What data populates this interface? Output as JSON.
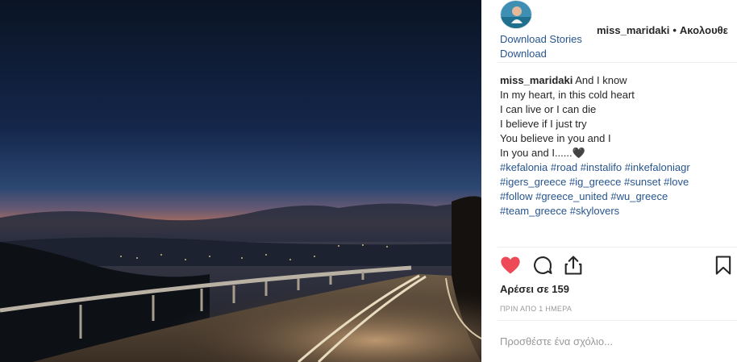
{
  "post": {
    "username": "miss_maridaki",
    "follow_label": "Ακολουθε",
    "dot": "•",
    "links": {
      "download_stories": "Download Stories",
      "download": "Download"
    },
    "caption": {
      "username": "miss_maridaki",
      "lines": [
        "And I know",
        "In my heart, in this cold heart",
        "I can live or I can die",
        "I believe if I just try",
        "You believe in you and I",
        "In you and I......🖤"
      ],
      "hashtag_lines": [
        [
          "#kefalonia",
          "#road",
          "#instalifo",
          "#inkefaloniagr"
        ],
        [
          "#igers_greece",
          "#ig_greece",
          "#sunset",
          "#love"
        ],
        [
          "#follow",
          "#greece_united",
          "#wu_greece"
        ],
        [
          "#team_greece",
          "#skylovers"
        ]
      ]
    },
    "likes_text": "Αρέσει σε 159",
    "time_ago": "ΠΡΙΝ ΑΠΟ 1 ΗΜΕΡΑ",
    "comment_placeholder": "Προσθέστε ένα σχόλιο...",
    "icons": {
      "like": "heart-icon",
      "comment": "comment-icon",
      "share": "share-icon",
      "save": "bookmark-icon"
    },
    "colors": {
      "heart": "#ed4956",
      "link": "#27558f",
      "muted": "#999999",
      "divider": "#efefef"
    }
  }
}
